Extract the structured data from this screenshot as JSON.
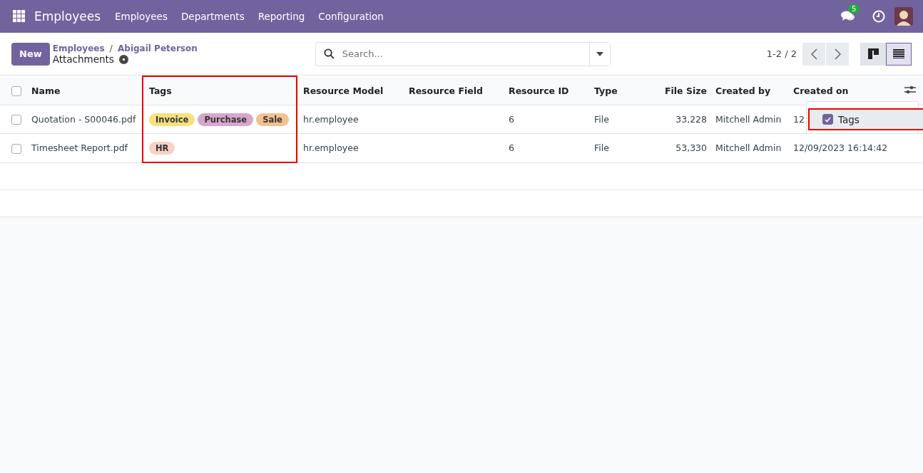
{
  "navbar": {
    "app_name": "Employees",
    "menu": [
      "Employees",
      "Departments",
      "Reporting",
      "Configuration"
    ],
    "message_count": "5"
  },
  "control_panel": {
    "new_button": "New",
    "breadcrumb": [
      "Employees",
      "Abigail Peterson"
    ],
    "breadcrumb_separator": "/",
    "title": "Attachments",
    "search": {
      "placeholder": "Search..."
    },
    "pager": "1-2 / 2",
    "views": [
      {
        "kind": "kanban",
        "selected": false
      },
      {
        "kind": "list",
        "selected": true
      }
    ]
  },
  "table": {
    "select_all_checked": false,
    "columns": [
      {
        "label": "Name",
        "highlighted": false
      },
      {
        "label": "Tags",
        "highlighted": true
      },
      {
        "label": "Resource Model",
        "highlighted": false
      },
      {
        "label": "Resource Field",
        "highlighted": false
      },
      {
        "label": "Resource ID",
        "highlighted": false
      },
      {
        "label": "Type",
        "highlighted": false
      },
      {
        "label": "File Size",
        "highlighted": false
      },
      {
        "label": "Created by",
        "highlighted": false
      },
      {
        "label": "Created on",
        "highlighted": false
      }
    ],
    "rows": [
      {
        "checked": false,
        "name": "Quotation - S00046.pdf",
        "tags": [
          {
            "label": "Invoice",
            "color": "#f7e07d"
          },
          {
            "label": "Purchase",
            "color": "#d8a6cd"
          },
          {
            "label": "Sale",
            "color": "#f5c08f"
          }
        ],
        "resource_model": "hr.employee",
        "resource_id": "6",
        "type": "File",
        "file_size": "33,228",
        "created_by": "Mitchell Admin",
        "created_on": "12"
      },
      {
        "checked": false,
        "name": "Timesheet Report.pdf",
        "tags": [
          {
            "label": "HR",
            "color": "#f6d2c4"
          }
        ],
        "resource_model": "hr.employee",
        "resource_id": "6",
        "type": "File",
        "file_size": "53,330",
        "created_by": "Mitchell Admin",
        "created_on": "12/09/2023 16:14:42"
      }
    ]
  },
  "column_menu": {
    "items": [
      {
        "label": "Tags",
        "checked": true,
        "highlighted": true
      }
    ]
  }
}
